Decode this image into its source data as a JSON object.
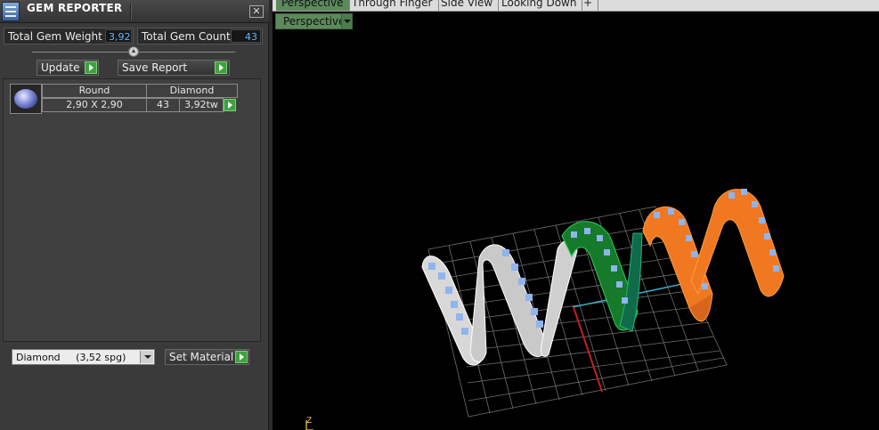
{
  "panel": {
    "title": "GEM REPORTER",
    "close_glyph": "✕",
    "total_weight_label": "Total Gem Weight",
    "total_weight_value": "3,92",
    "total_count_label": "Total Gem Count",
    "total_count_value": "43",
    "update_label": "Update",
    "save_report_label": "Save Report",
    "gem_rows": [
      {
        "shape": "Round",
        "material": "Diamond",
        "size": "2,90 X 2,90",
        "count": "43",
        "weight": "3,92tw"
      }
    ],
    "material_select_value": "Diamond     (3,52 spg)",
    "set_material_label": "Set Material"
  },
  "viewport": {
    "tabs": [
      "Perspective",
      "Through Finger",
      "Side View",
      "Looking Down",
      "+"
    ],
    "active_tab": "Perspective",
    "view_menu_label": "Perspective",
    "axis_label": "Z"
  },
  "colors": {
    "accent_green": "#3da23d",
    "tab_active": "#5c8a5c",
    "value_blue": "#5fb8ff",
    "gem_blue": "#8fb4ee",
    "ring_white": "#d8d8d8",
    "ring_green": "#157a2a",
    "ring_orange": "#f07820"
  },
  "icons": {
    "app": "gem-reporter-icon",
    "close": "close-icon",
    "go": "play-arrow-icon",
    "dropdown": "chevron-down-icon",
    "slider": "slider-knob-icon"
  }
}
